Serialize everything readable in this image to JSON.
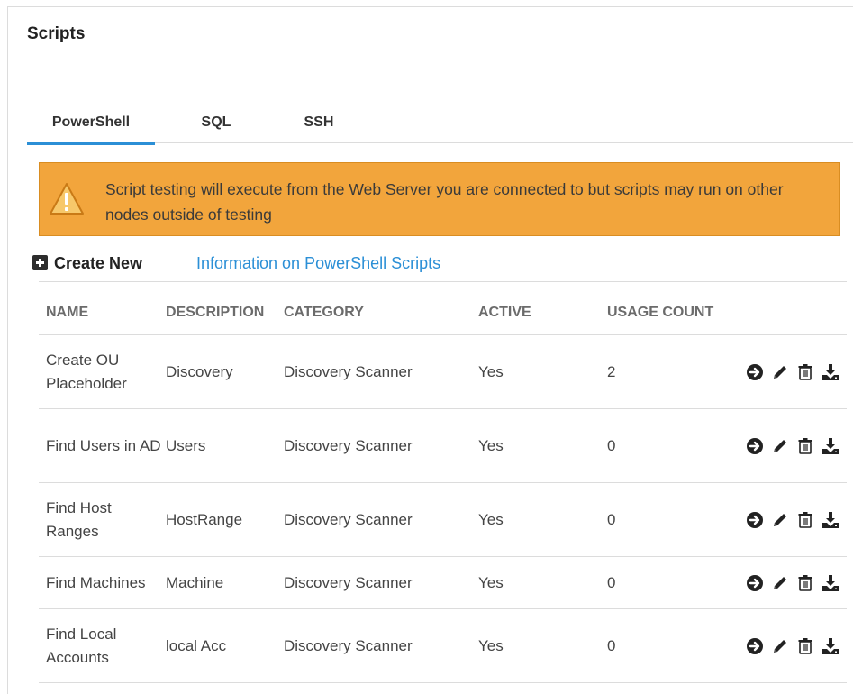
{
  "page": {
    "title": "Scripts"
  },
  "tabs": [
    {
      "label": "PowerShell",
      "active": true
    },
    {
      "label": "SQL",
      "active": false
    },
    {
      "label": "SSH",
      "active": false
    }
  ],
  "alert": {
    "icon": "warning-icon",
    "text": "Script testing will execute from the Web Server you are connected to but scripts may run on other nodes outside of testing"
  },
  "actions": {
    "create_new": "Create New",
    "info_link": "Information on PowerShell Scripts"
  },
  "table": {
    "columns": [
      "NAME",
      "DESCRIPTION",
      "CATEGORY",
      "ACTIVE",
      "USAGE COUNT"
    ],
    "rows": [
      {
        "name": "Create OU Placeholder",
        "description": "Discovery",
        "category": "Discovery Scanner",
        "active": "Yes",
        "usage_count": "2"
      },
      {
        "name": "Find Users in AD",
        "description": "Users",
        "category": "Discovery Scanner",
        "active": "Yes",
        "usage_count": "0"
      },
      {
        "name": "Find Host Ranges",
        "description": "HostRange",
        "category": "Discovery Scanner",
        "active": "Yes",
        "usage_count": "0"
      },
      {
        "name": "Find Machines",
        "description": "Machine",
        "category": "Discovery Scanner",
        "active": "Yes",
        "usage_count": "0"
      },
      {
        "name": "Find Local Accounts",
        "description": "local Acc",
        "category": "Discovery Scanner",
        "active": "Yes",
        "usage_count": "0"
      }
    ],
    "row_actions": [
      "run-icon",
      "edit-pencil-icon",
      "delete-trash-icon",
      "download-icon"
    ]
  },
  "colors": {
    "accent": "#2b8fd6",
    "alert_bg": "#f2a53c",
    "alert_icon": "#f7b547"
  }
}
